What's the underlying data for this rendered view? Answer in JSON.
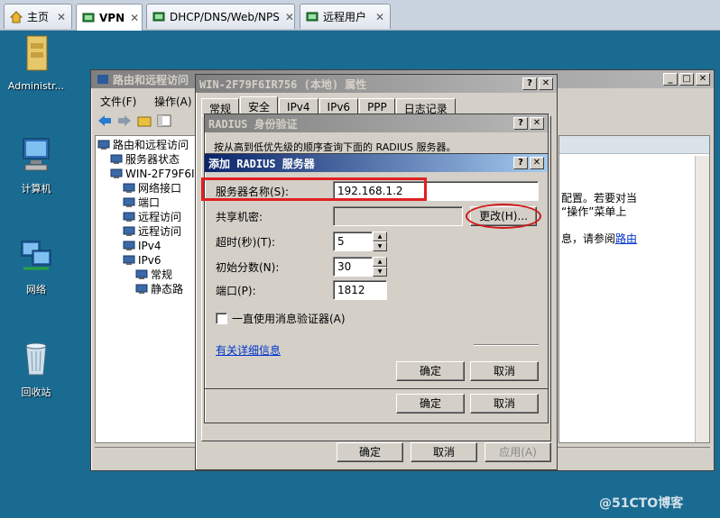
{
  "tabs": [
    {
      "label": "主页",
      "icon": "home-icon"
    },
    {
      "label": "VPN",
      "icon": "server-icon"
    },
    {
      "label": "DHCP/DNS/Web/NPS",
      "icon": "server-icon"
    },
    {
      "label": "远程用户",
      "icon": "server-icon"
    }
  ],
  "desktop": {
    "administrator": "Administr...",
    "computer": "计算机",
    "network": "网络",
    "recycle": "回收站"
  },
  "rras": {
    "title": "路由和远程访问",
    "menu": {
      "file": "文件(F)",
      "action": "操作(A)"
    },
    "tree": [
      {
        "label": "路由和远程访问",
        "level": 0
      },
      {
        "label": "服务器状态",
        "level": 1
      },
      {
        "label": "WIN-2F79F6I",
        "level": 1
      },
      {
        "label": "网络接口",
        "level": 2
      },
      {
        "label": "端口",
        "level": 2
      },
      {
        "label": "远程访问",
        "level": 2
      },
      {
        "label": "远程访问",
        "level": 2
      },
      {
        "label": "IPv4",
        "level": 2
      },
      {
        "label": "IPv6",
        "level": 2
      },
      {
        "label": "常规",
        "level": 3
      },
      {
        "label": "静态路",
        "level": 3
      }
    ],
    "right_text": {
      "line1": "配置。若要对当",
      "line2": "“操作”菜单上",
      "line3": "息，请参阅",
      "link": "路由"
    }
  },
  "props": {
    "title": "WIN-2F79F6IR756 (本地) 属性",
    "tabs": [
      "常规",
      "安全",
      "IPv4",
      "IPv6",
      "PPP",
      "日志记录"
    ],
    "ok": "确定",
    "cancel": "取消",
    "apply": "应用(A)"
  },
  "radius_auth": {
    "title": "RADIUS 身份验证",
    "desc": "按从高到低优先级的顺序查询下面的 RADIUS 服务器。",
    "ok": "确定",
    "cancel": "取消"
  },
  "add_radius": {
    "title": "添加 RADIUS 服务器",
    "server_name_label": "服务器名称(S):",
    "server_name_value": "192.168.1.2",
    "shared_secret_label": "共享机密:",
    "change_button": "更改(H)...",
    "timeout_label": "超时(秒)(T):",
    "timeout_value": "5",
    "initial_score_label": "初始分数(N):",
    "initial_score_value": "30",
    "port_label": "端口(P):",
    "port_value": "1812",
    "always_use_authenticator": "一直使用消息验证器(A)",
    "always_use_authenticator_checked": false,
    "more_info_link": "有关详细信息",
    "ok": "确定",
    "cancel": "取消"
  },
  "watermark": "@51CTO博客"
}
